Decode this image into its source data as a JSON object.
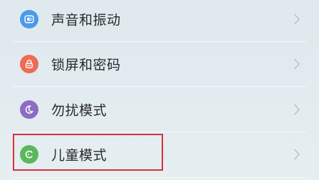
{
  "settings": {
    "items": [
      {
        "label": "声音和振动",
        "icon": "speaker-icon",
        "icon_color": "#4b9ae8"
      },
      {
        "label": "锁屏和密码",
        "icon": "lock-icon",
        "icon_color": "#ee6b55"
      },
      {
        "label": "勿扰模式",
        "icon": "moon-icon",
        "icon_color": "#8e6cc4"
      },
      {
        "label": "儿童模式",
        "icon": "child-icon",
        "icon_color": "#5ab85c"
      }
    ]
  },
  "highlight": {
    "color": "#d9303a"
  }
}
